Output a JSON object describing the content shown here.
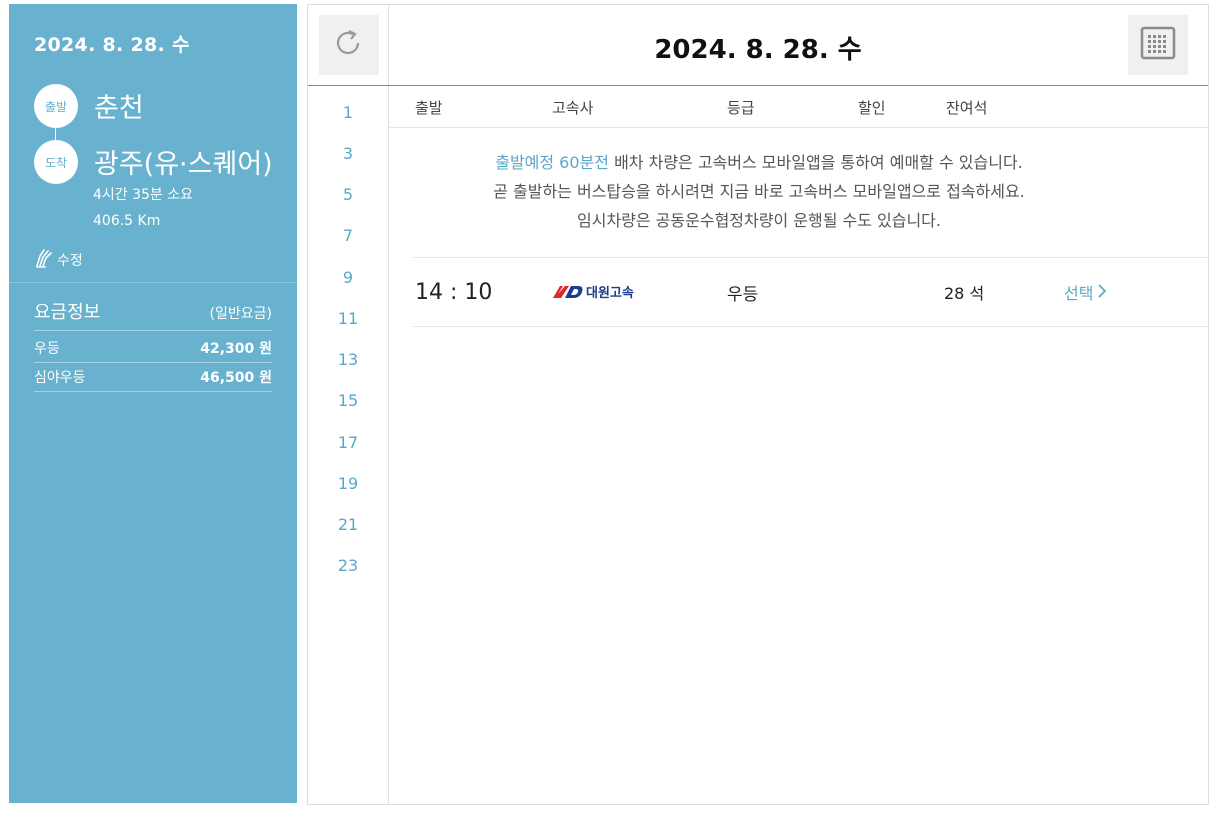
{
  "sidebar": {
    "date": "2024. 8. 28. 수",
    "departure_label": "출발",
    "departure_city": "춘천",
    "arrival_label": "도착",
    "arrival_city": "광주(유·스퀘어)",
    "duration": "4시간 35분 소요",
    "distance": "406.5 Km",
    "edit_label": "수정",
    "fare_title": "요금정보",
    "fare_type": "(일반요금)",
    "fares": [
      {
        "grade": "우등",
        "price": "42,300 원"
      },
      {
        "grade": "심야우등",
        "price": "46,500 원"
      }
    ]
  },
  "main": {
    "date": "2024. 8. 28. 수",
    "hours": [
      "1",
      "3",
      "5",
      "7",
      "9",
      "11",
      "13",
      "15",
      "17",
      "19",
      "21",
      "23"
    ],
    "columns": {
      "departure": "출발",
      "company": "고속사",
      "grade": "등급",
      "discount": "할인",
      "seats": "잔여석"
    },
    "notice": {
      "highlight": "출발예정 60분전",
      "line1_rest": " 배차 차량은 고속버스 모바일앱을 통하여 예매할 수 있습니다.",
      "line2": "곧 출발하는 버스탑승을 하시려면 지금 바로 고속버스 모바일앱으로 접속하세요.",
      "line3": "임시차량은 공동운수협정차량이 운행될 수도 있습니다."
    },
    "buses": [
      {
        "time": "14 : 10",
        "company_logo_text": "대원고속",
        "grade": "우등",
        "discount": "",
        "seats": "28 석",
        "select_label": "선택"
      }
    ]
  },
  "colors": {
    "sidebar_bg": "#68b2cf",
    "accent": "#5aa8c9"
  },
  "icons": {
    "refresh": "refresh-icon",
    "calendar": "calendar-icon",
    "edit": "edit-icon",
    "select": "chevron-right-icon"
  }
}
